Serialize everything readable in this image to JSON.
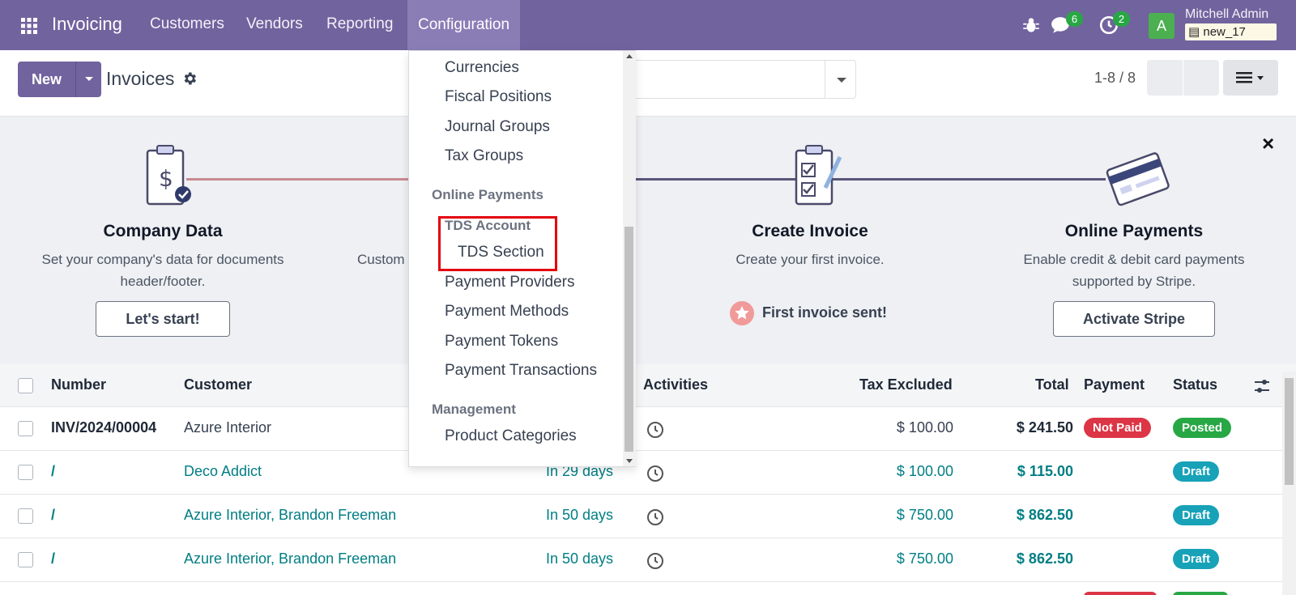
{
  "navbar": {
    "app_name": "Invoicing",
    "menu": [
      "Customers",
      "Vendors",
      "Reporting",
      "Configuration"
    ],
    "messages_count": "6",
    "activities_count": "2",
    "avatar_letter": "A",
    "user_name": "Mitchell Admin",
    "db_name": "new_17",
    "icons": [
      "apps-icon",
      "bug-icon",
      "chat-icon",
      "clock-icon",
      "database-icon"
    ]
  },
  "control_panel": {
    "new_label": "New",
    "title": "Invoices",
    "pager": "1-8 / 8"
  },
  "onboarding": {
    "steps": [
      {
        "title": "Company Data",
        "desc": "Set your company's data for documents header/footer.",
        "button": "Let's start!"
      },
      {
        "title": "",
        "desc": "Custom",
        "button": ""
      },
      {
        "title": "Create Invoice",
        "desc": "Create your first invoice.",
        "done": "First invoice sent!"
      },
      {
        "title": "Online Payments",
        "desc": "Enable credit & debit card payments supported by Stripe.",
        "button": "Activate Stripe"
      }
    ],
    "close": "×"
  },
  "list": {
    "columns": [
      "Number",
      "Customer",
      "Activities",
      "Tax Excluded",
      "Total",
      "Payment",
      "Status"
    ],
    "rows": [
      {
        "number": "INV/2024/00004",
        "customer": "Azure Interior",
        "due": "",
        "tax_excluded": "$ 100.00",
        "total": "$ 241.50",
        "payment": "Not Paid",
        "status": "Posted"
      },
      {
        "number": "/",
        "customer": "Deco Addict",
        "due": "In 29 days",
        "tax_excluded": "$ 100.00",
        "total": "$ 115.00",
        "payment": "",
        "status": "Draft"
      },
      {
        "number": "/",
        "customer": "Azure Interior, Brandon Freeman",
        "due": "In 50 days",
        "tax_excluded": "$ 750.00",
        "total": "$ 862.50",
        "payment": "",
        "status": "Draft"
      },
      {
        "number": "/",
        "customer": "Azure Interior, Brandon Freeman",
        "due": "In 50 days",
        "tax_excluded": "$ 750.00",
        "total": "$ 862.50",
        "payment": "",
        "status": "Draft"
      }
    ]
  },
  "dropdown": {
    "items_top": [
      "Currencies",
      "Fiscal Positions",
      "Journal Groups",
      "Tax Groups"
    ],
    "header_online_payments": "Online Payments",
    "tds_account": "TDS Account",
    "tds_section": "TDS Section",
    "items_payments": [
      "Payment Providers",
      "Payment Methods",
      "Payment Tokens",
      "Payment Transactions"
    ],
    "header_management": "Management",
    "items_management": [
      "Product Categories"
    ]
  },
  "colors": {
    "brand": "#71639e",
    "link": "#017e84",
    "not_paid": "#dc3545",
    "posted": "#28a745",
    "draft": "#17a2b8",
    "highlight": "#e3000f"
  }
}
